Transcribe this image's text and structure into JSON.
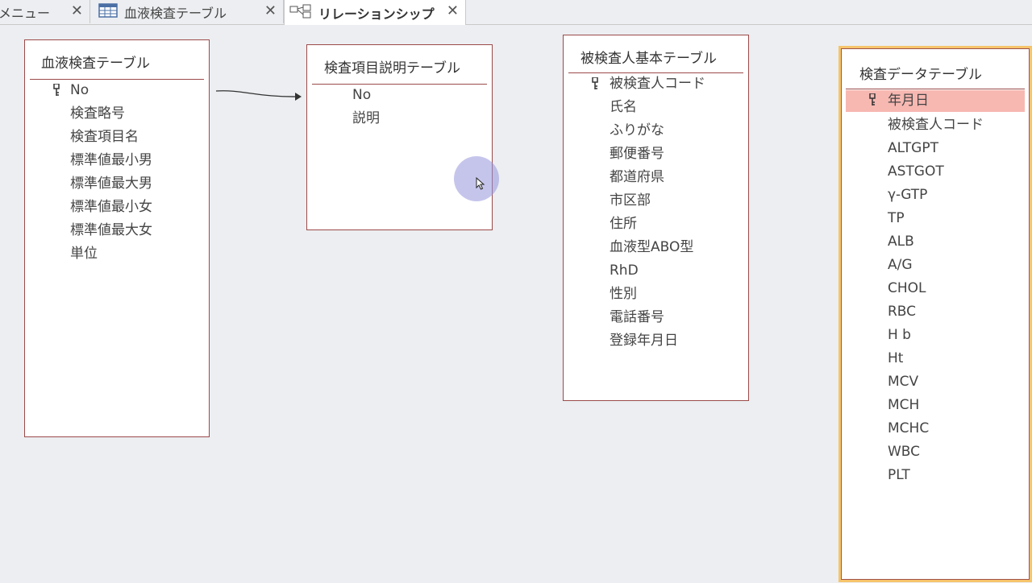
{
  "tabs": [
    {
      "label": "メニュー",
      "icon": "none"
    },
    {
      "label": "血液検査テーブル",
      "icon": "table-icon"
    },
    {
      "label": "リレーションシップ",
      "icon": "relationship-icon"
    }
  ],
  "tables": {
    "blood_test": {
      "title": "血液検査テーブル",
      "fields": [
        "No",
        "検査略号",
        "検査項目名",
        "標準値最小男",
        "標準値最大男",
        "標準値最小女",
        "標準値最大女",
        "単位"
      ],
      "key_field": "No"
    },
    "item_desc": {
      "title": "検査項目説明テーブル",
      "fields": [
        "No",
        "説明"
      ]
    },
    "examinee": {
      "title": "被検査人基本テーブル",
      "fields": [
        "被検査人コード",
        "氏名",
        "ふりがな",
        "郵便番号",
        "都道府県",
        "市区部",
        "住所",
        "血液型ABO型",
        "RhD",
        "性別",
        "電話番号",
        "登録年月日"
      ],
      "key_field": "被検査人コード"
    },
    "test_data": {
      "title": "検査データテーブル",
      "fields": [
        "年月日",
        "被検査人コード",
        "ALTGPT",
        "ASTGOT",
        "γ-GTP",
        "TP",
        "ALB",
        "A/G",
        "CHOL",
        "RBC",
        "H b",
        "Ht",
        "MCV",
        "MCH",
        "MCHC",
        "WBC",
        "PLT"
      ],
      "key_field": "年月日",
      "selected_field": "年月日"
    }
  },
  "relationship": {
    "from": "血液検査テーブル.No",
    "to": "検査項目説明テーブル.No"
  },
  "colors": {
    "table_border": "#9c4a4a",
    "selected_border": "#f6c46a",
    "selected_field_bg": "#f7b8b2",
    "canvas_bg": "#eceef1"
  }
}
